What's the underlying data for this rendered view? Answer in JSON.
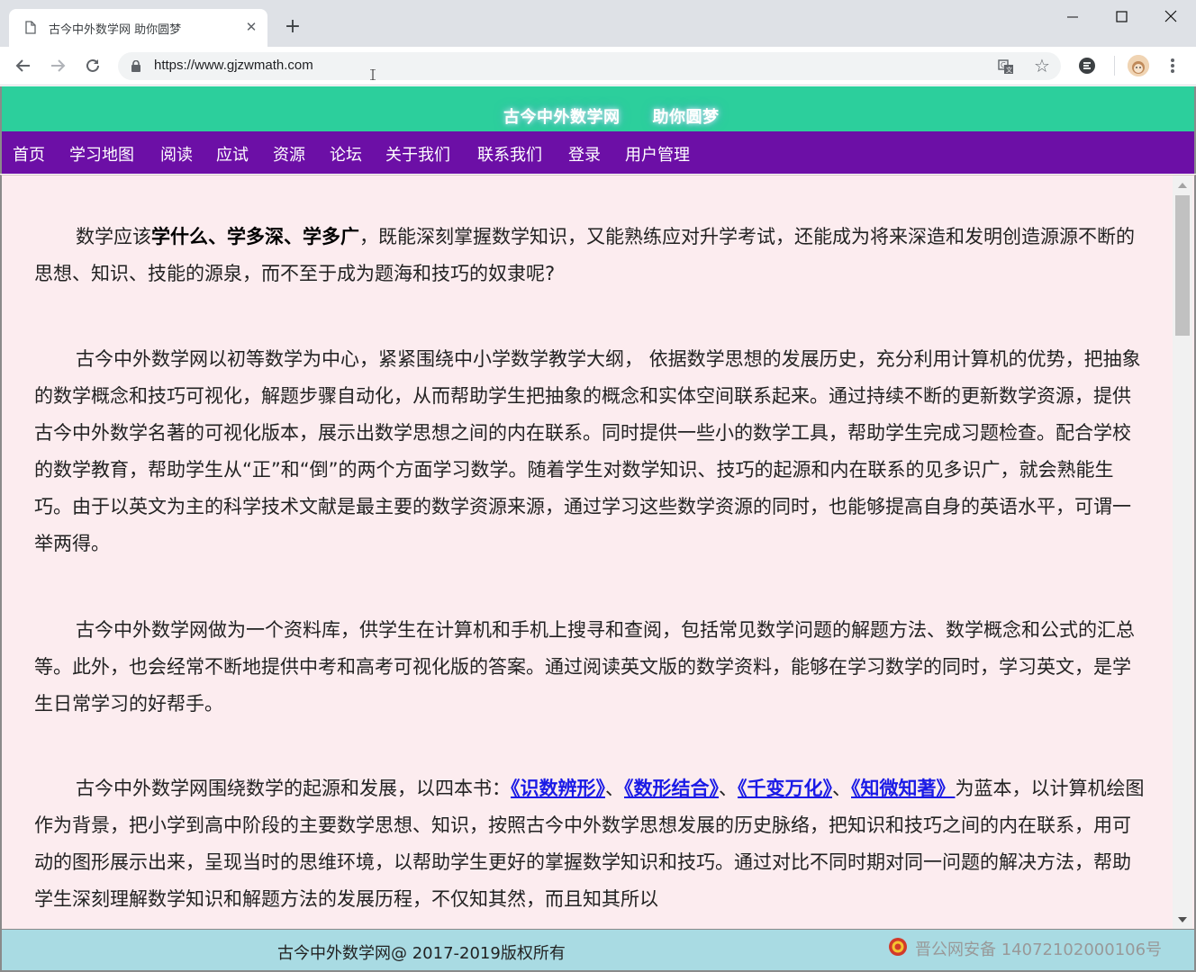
{
  "browser": {
    "tab_title": "古今中外数学网 助你圆梦",
    "url": "https://www.gjzwmath.com"
  },
  "site": {
    "banner": [
      "古今中外数学网",
      "助你圆梦"
    ],
    "nav": [
      "首页",
      "学习地图",
      "阅读",
      "应试",
      "资源",
      "论坛",
      "关于我们",
      "联系我们",
      "登录",
      "用户管理"
    ]
  },
  "content": {
    "p1_pre": "数学应该",
    "p1_bold": "学什么、学多深、学多广",
    "p1_post": "，既能深刻掌握数学知识，又能熟练应对升学考试，还能成为将来深造和发明创造源源不断的思想、知识、技能的源泉，而不至于成为题海和技巧的奴隶呢?",
    "p2": "古今中外数学网以初等数学为中心，紧紧围绕中小学数学教学大纲， 依据数学思想的发展历史，充分利用计算机的优势，把抽象的数学概念和技巧可视化，解题步骤自动化，从而帮助学生把抽象的概念和实体空间联系起来。通过持续不断的更新数学资源，提供古今中外数学名著的可视化版本，展示出数学思想之间的内在联系。同时提供一些小的数学工具，帮助学生完成习题检查。配合学校的数学教育，帮助学生从“正”和“倒”的两个方面学习数学。随着学生对数学知识、技巧的起源和内在联系的见多识广，就会熟能生巧。由于以英文为主的科学技术文献是最主要的数学资源来源，通过学习这些数学资源的同时，也能够提高自身的英语水平，可谓一举两得。",
    "p3": "古今中外数学网做为一个资料库，供学生在计算机和手机上搜寻和查阅，包括常见数学问题的解题方法、数学概念和公式的汇总等。此外，也会经常不断地提供中考和高考可视化版的答案。通过阅读英文版的数学资料，能够在学习数学的同时，学习英文，是学生日常学习的好帮手。",
    "p4_pre": "古今中外数学网围绕数学的起源和发展，以四本书：",
    "books": [
      "《识数辨形》",
      "《数形结合》",
      "《千变万化》",
      "《知微知著》"
    ],
    "sep": "、",
    "p4_post": "为蓝本，以计算机绘图作为背景，把小学到高中阶段的主要数学思想、知识，按照古今中外数学思想发展的历史脉络，把知识和技巧之间的内在联系，用可动的图形展示出来，呈现当时的思维环境，以帮助学生更好的掌握数学知识和技巧。通过对比不同时期对同一问题的解决方法，帮助学生深刻理解数学知识和解题方法的发展历程，不仅知其然，而且知其所以"
  },
  "footer": {
    "copyright": "古今中外数学网@ 2017-2019版权所有",
    "beian": "晋公网安备 14072102000106号"
  },
  "colors": {
    "banner": "#2ccf9c",
    "nav": "#6c0fa6",
    "content_bg": "#fcecef",
    "footer": "#a9dbe3",
    "link": "#1a1ae6"
  }
}
